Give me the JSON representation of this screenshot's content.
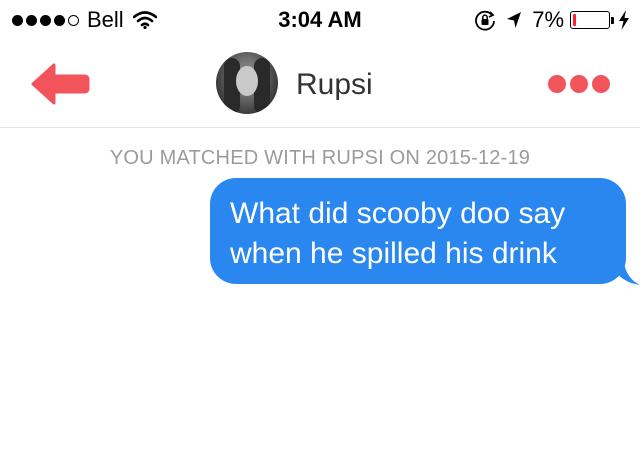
{
  "status_bar": {
    "carrier": "Bell",
    "signal_bars": 4,
    "signal_max": 5,
    "time": "3:04 AM",
    "battery_percent": "7%",
    "battery_level": 0.07,
    "battery_color": "#ff1f2e",
    "icons": [
      "wifi-icon",
      "rotation-lock-icon",
      "location-arrow-icon",
      "battery-icon",
      "charging-bolt-icon"
    ]
  },
  "nav": {
    "back_icon": "back-arrow-icon",
    "contact_name": "Rupsi",
    "more_icon": "more-dots-icon",
    "accent_color": "#f2545b"
  },
  "conversation": {
    "match_notice": "YOU MATCHED WITH RUPSI ON 2015-12-19",
    "messages": [
      {
        "sender": "me",
        "lines": [
          "What did scooby doo say",
          "when he spilled his drink"
        ],
        "color": "#2b87f0"
      }
    ]
  }
}
